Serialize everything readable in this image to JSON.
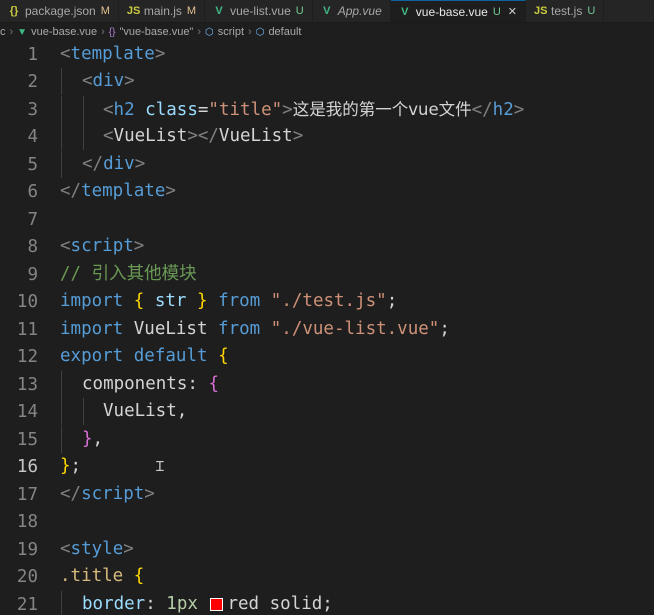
{
  "tabs": [
    {
      "label": "package.json",
      "badge": "M",
      "icon": "json-icon",
      "icon_glyph": "{}",
      "active": false
    },
    {
      "label": "main.js",
      "badge": "M",
      "icon": "js-icon",
      "icon_glyph": "JS",
      "active": false
    },
    {
      "label": "vue-list.vue",
      "badge": "U",
      "icon": "vue-icon",
      "icon_glyph": "V",
      "active": false
    },
    {
      "label": "App.vue",
      "badge": "",
      "icon": "vue-icon",
      "icon_glyph": "V",
      "active": false
    },
    {
      "label": "vue-base.vue",
      "badge": "U",
      "icon": "vue-icon",
      "icon_glyph": "V",
      "active": true,
      "close": "✕"
    },
    {
      "label": "test.js",
      "badge": "U",
      "icon": "js-icon",
      "icon_glyph": "JS",
      "active": false
    }
  ],
  "breadcrumb": {
    "root": "c",
    "file": "vue-base.vue",
    "object": "\"vue-base.vue\"",
    "script": "script",
    "default": "default"
  },
  "line_numbers": [
    "1",
    "2",
    "3",
    "4",
    "5",
    "6",
    "7",
    "8",
    "9",
    "10",
    "11",
    "12",
    "13",
    "14",
    "15",
    "16",
    "17",
    "18",
    "19",
    "20",
    "21"
  ],
  "current_line": "16",
  "code": {
    "l1": [
      "<",
      "template",
      ">"
    ],
    "l2": [
      "<",
      "div",
      ">"
    ],
    "l3": [
      "<",
      "h2",
      " ",
      "class",
      "=",
      "\"title\"",
      ">",
      "这是我的第一个vue文件",
      "</",
      "h2",
      ">"
    ],
    "l4": [
      "<",
      "VueList",
      "></",
      "VueList",
      ">"
    ],
    "l5": [
      "</",
      "div",
      ">"
    ],
    "l6": [
      "</",
      "template",
      ">"
    ],
    "l8": [
      "<",
      "script",
      ">"
    ],
    "l9": "// 引入其他模块",
    "l10": [
      "import",
      " ",
      "{",
      " str ",
      "}",
      " ",
      "from",
      " ",
      "\"./test.js\"",
      ";"
    ],
    "l11": [
      "import",
      " VueList ",
      "from",
      " ",
      "\"./vue-list.vue\"",
      ";"
    ],
    "l12": [
      "export",
      " ",
      "default",
      " ",
      "{"
    ],
    "l13": [
      "components",
      ": ",
      "{"
    ],
    "l14": "VueList,",
    "l15": [
      "}",
      ","
    ],
    "l16": [
      "}",
      ";"
    ],
    "l17": [
      "</",
      "script",
      ">"
    ],
    "l19": [
      "<",
      "style",
      ">"
    ],
    "l20": [
      ".title",
      " ",
      "{"
    ],
    "l21": [
      "border",
      ": ",
      "1px",
      " ",
      "red solid;"
    ]
  },
  "colors": {
    "background": "#1e1e1e",
    "tag": "#569cd6",
    "string": "#ce9178",
    "keyword": "#c586c0",
    "comment": "#6a9955",
    "component": "#4ec9b0",
    "swatch_red": "#ff0000"
  }
}
